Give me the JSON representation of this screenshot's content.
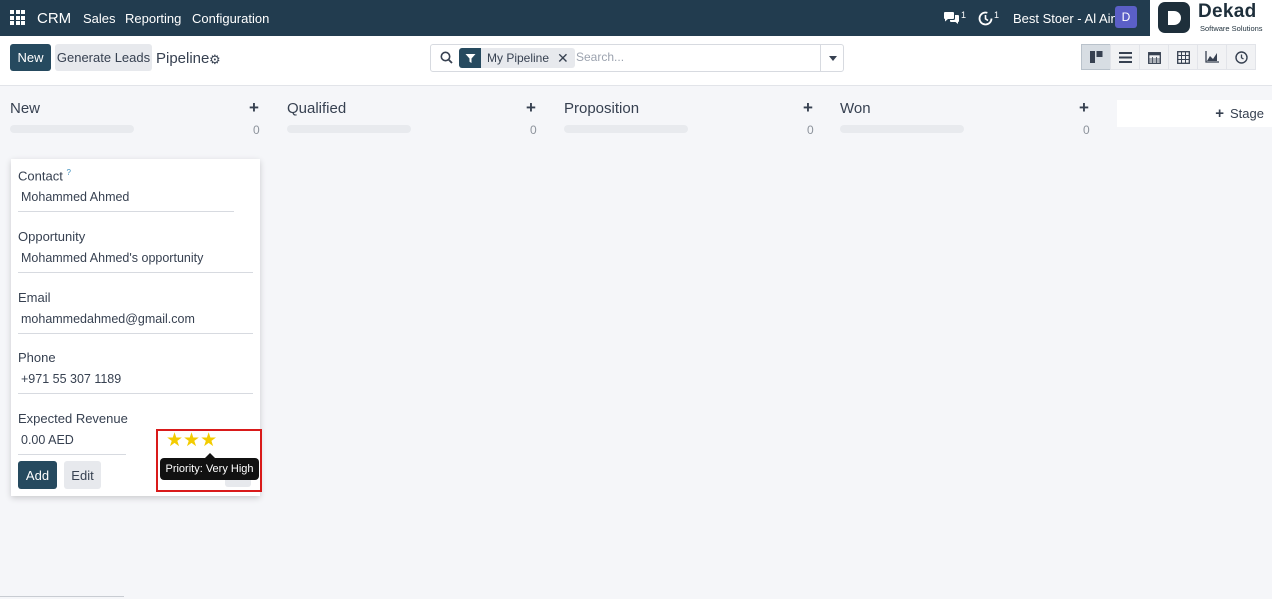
{
  "navbar": {
    "brand": "CRM",
    "menu": [
      "Sales",
      "Reporting",
      "Configuration"
    ],
    "messages_count": "1",
    "activities_count": "1",
    "company": "Best Stoer - Al Ain",
    "avatar_letter": "D",
    "logo_name": "Dekad",
    "logo_sub": "Software Solutions"
  },
  "control": {
    "new_label": "New",
    "generate_label": "Generate Leads",
    "title": "Pipeline",
    "search": {
      "facet": "My Pipeline",
      "placeholder": "Search..."
    },
    "views": [
      "kanban-icon",
      "list-icon",
      "calendar-icon",
      "pivot-icon",
      "graph-icon",
      "activity-icon"
    ]
  },
  "kanban": {
    "columns": [
      {
        "title": "New",
        "count": "0"
      },
      {
        "title": "Qualified",
        "count": "0"
      },
      {
        "title": "Proposition",
        "count": "0"
      },
      {
        "title": "Won",
        "count": "0"
      }
    ],
    "add_stage_label": "Stage"
  },
  "quick_create": {
    "contact_label": "Contact",
    "contact_help": "?",
    "contact_value": "Mohammed Ahmed",
    "opportunity_label": "Opportunity",
    "opportunity_value": "Mohammed Ahmed's opportunity",
    "email_label": "Email",
    "email_value": "mohammedahmed@gmail.com",
    "phone_label": "Phone",
    "phone_value": "+971 55 307 1189",
    "revenue_label": "Expected Revenue",
    "revenue_value": "0.00 AED",
    "priority_stars": 3,
    "add_label": "Add",
    "edit_label": "Edit"
  },
  "tooltip": "Priority: Very High",
  "colors": {
    "navbar": "#223c4f",
    "primary": "#264a5f",
    "star": "#f3cc00",
    "highlight": "#d91a1a"
  }
}
